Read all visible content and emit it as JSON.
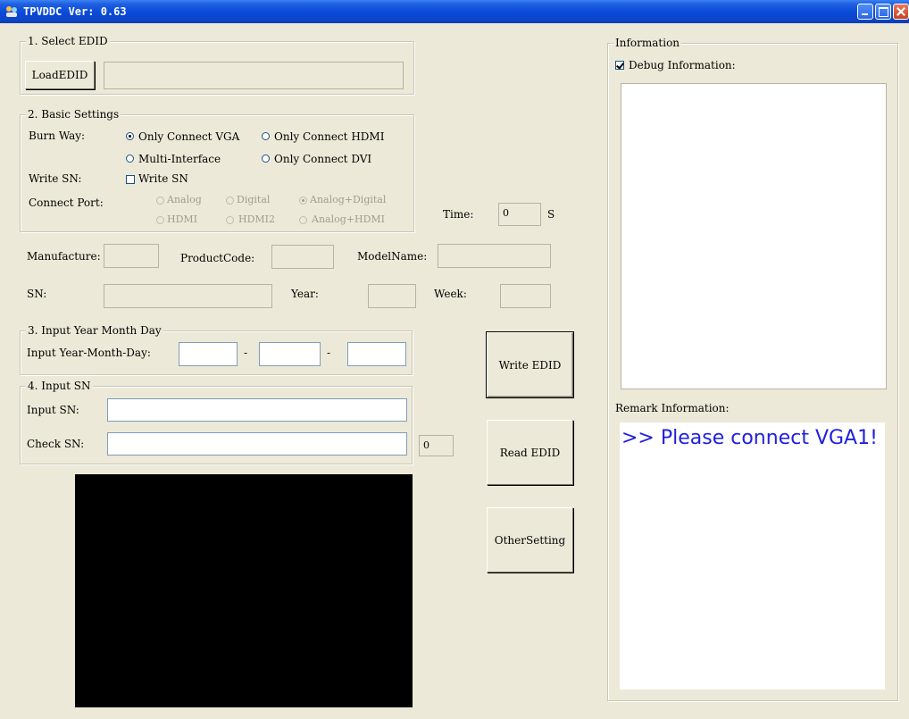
{
  "window": {
    "title": "TPVDDC  Ver: 0.63",
    "title_color": "#0a4ad6"
  },
  "select_edid": {
    "legend": "1. Select EDID",
    "load_button": "LoadEDID",
    "path_value": ""
  },
  "basic_settings": {
    "legend": "2. Basic Settings",
    "burn_way_label": "Burn Way:",
    "burn_way_options": [
      "Only Connect VGA",
      "Only Connect HDMI",
      "Multi-Interface",
      "Only Connect DVI"
    ],
    "burn_way_selected": "Only Connect VGA",
    "write_sn_label": "Write SN:",
    "write_sn_checkbox": "Write SN",
    "write_sn_checked": false,
    "connect_port_label": "Connect Port:",
    "connect_port_options": [
      "Analog",
      "Digital",
      "Analog+Digital",
      "HDMI",
      "HDMI2",
      "Analog+HDMI"
    ],
    "connect_port_selected": "Analog+Digital"
  },
  "time": {
    "label": "Time:",
    "value": "0",
    "unit": "S"
  },
  "edid_fields": {
    "manufacture_label": "Manufacture:",
    "productcode_label": "ProductCode:",
    "modelname_label": "ModelName:",
    "sn_label": "SN:",
    "year_label": "Year:",
    "week_label": "Week:"
  },
  "input_date": {
    "legend": "3. Input Year Month Day",
    "label": "Input Year-Month-Day:",
    "separator": "-"
  },
  "input_sn": {
    "legend": "4. Input SN",
    "input_label": "Input SN:",
    "check_label": "Check SN:",
    "count_value": "0"
  },
  "actions": {
    "write_edid": "Write EDID",
    "read_edid": "Read EDID",
    "other_setting": "OtherSetting"
  },
  "information": {
    "legend": "Information",
    "debug_checkbox": "Debug Information:",
    "debug_checked": true,
    "remark_label": "Remark Information:",
    "remark_text": ">> Please connect VGA1!",
    "remark_color": "#2020e0"
  },
  "icons": {
    "app": "app-icon",
    "minimize": "minimize-icon",
    "maximize": "maximize-icon",
    "close": "close-icon"
  }
}
